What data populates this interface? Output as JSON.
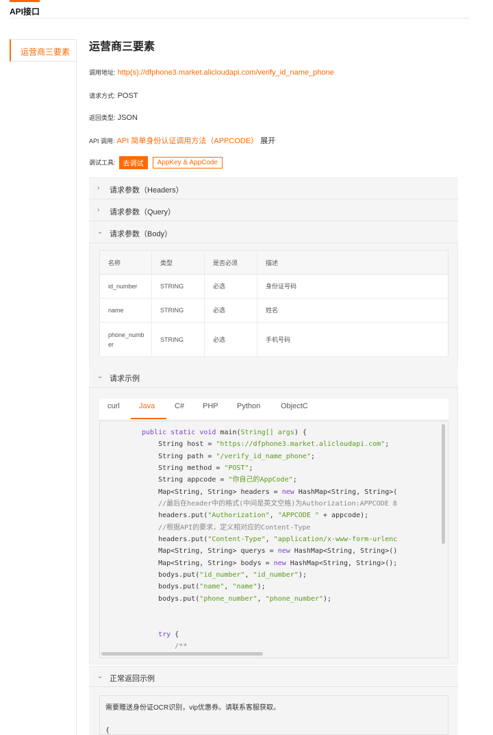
{
  "header": {
    "title": "API接口"
  },
  "sidebar": {
    "items": [
      {
        "label": "运营商三要素"
      }
    ]
  },
  "page_title": "运营商三要素",
  "info": {
    "url_label": "调用地址:",
    "url_value": "http(s)://dfphone3.market.alicloudapi.com/verify_id_name_phone",
    "method_label": "请求方式:",
    "method_value": "POST",
    "return_label": "返回类型:",
    "return_value": "JSON",
    "api_call_label": "API 调用:",
    "api_call_link": "API 简单身份认证调用方法（APPCODE）",
    "api_call_expand": "展开",
    "tool_label": "调试工具:",
    "try_button": "去调试",
    "appkey_button": "AppKey & AppCode"
  },
  "sections": {
    "headers": "请求参数（Headers）",
    "query": "请求参数（Query）",
    "body": "请求参数（Body）",
    "example": "请求示例",
    "response": "正常返回示例"
  },
  "params_table": {
    "columns": [
      "名称",
      "类型",
      "是否必须",
      "描述"
    ],
    "rows": [
      [
        "id_number",
        "STRING",
        "必选",
        "身份证号码"
      ],
      [
        "name",
        "STRING",
        "必选",
        "姓名"
      ],
      [
        "phone_number",
        "STRING",
        "必选",
        "手机号码"
      ]
    ]
  },
  "lang_tabs": [
    "curl",
    "Java",
    "C#",
    "PHP",
    "Python",
    "ObjectC"
  ],
  "active_tab": "Java",
  "code_lines": [
    "public static void main(String[] args) {",
    "    String host = \"https://dfphone3.market.alicloudapi.com\";",
    "    String path = \"/verify_id_name_phone\";",
    "    String method = \"POST\";",
    "    String appcode = \"你自己的AppCode\";",
    "    Map<String, String> headers = new HashMap<String, String>(",
    "    //最后在header中的格式(中间是英文空格)为Authorization:APPCODE 8",
    "    headers.put(\"Authorization\", \"APPCODE \" + appcode);",
    "    //根据API的要求，定义相对应的Content-Type",
    "    headers.put(\"Content-Type\", \"application/x-www-form-urlenc",
    "    Map<String, String> querys = new HashMap<String, String>()",
    "    Map<String, String> bodys = new HashMap<String, String>();",
    "    bodys.put(\"id_number\", \"id_number\");",
    "    bodys.put(\"name\", \"name\");",
    "    bodys.put(\"phone_number\", \"phone_number\");",
    "",
    "",
    "    try {",
    "        /**"
  ],
  "response": {
    "note": "需要赠送身份证OCR识别，vip优惠券。请联系客服获取。",
    "brace": "{"
  },
  "colors": {
    "accent": "#ff6a00",
    "keyword": "#7b3fd1",
    "string": "#5a9a1a"
  }
}
